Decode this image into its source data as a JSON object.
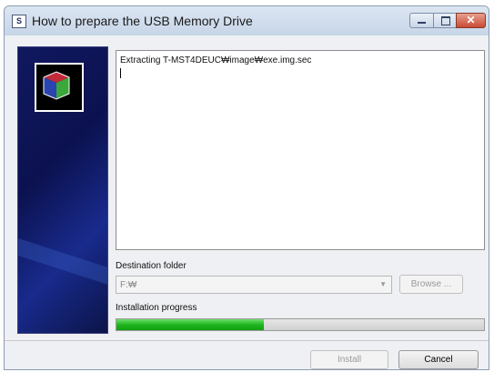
{
  "window": {
    "title": "How to prepare the USB Memory Drive",
    "icon_label": "S"
  },
  "log": {
    "lines": [
      "Extracting T-MST4DEUC₩image₩exe.img.sec"
    ]
  },
  "destination": {
    "label": "Destination folder",
    "value": "F:₩",
    "browse_label": "Browse ..."
  },
  "progress": {
    "label": "Installation progress",
    "fraction": 0.4
  },
  "buttons": {
    "install_label": "Install",
    "cancel_label": "Cancel"
  },
  "icons": {
    "logo": "cube-logo-icon",
    "minimize": "minimize-icon",
    "maximize": "maximize-icon",
    "close": "close-icon"
  },
  "colors": {
    "progress_green": "#1fb51f",
    "sidebar_blue": "#101860",
    "close_red": "#c84a35"
  }
}
